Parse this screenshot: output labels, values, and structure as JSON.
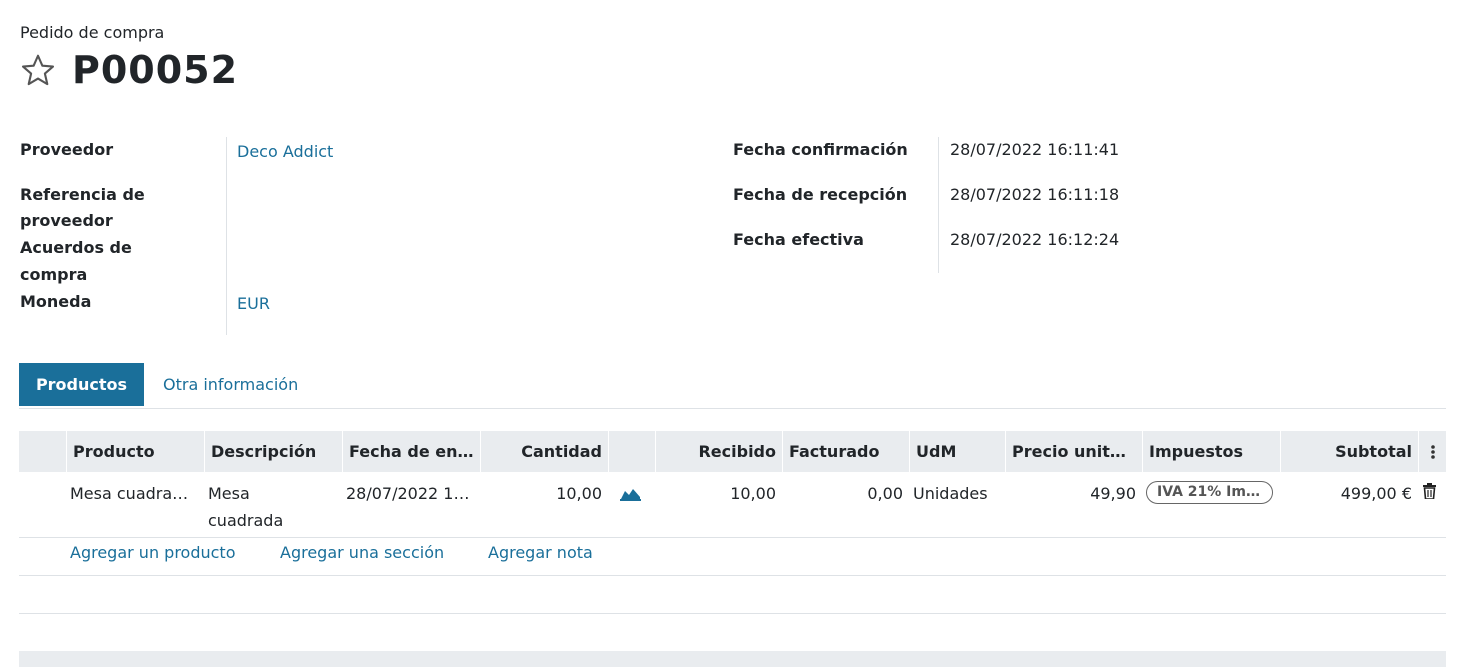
{
  "header": {
    "subtitle": "Pedido de compra",
    "title": "P00052"
  },
  "left_fields": {
    "vendor_label": "Proveedor",
    "vendor_value": "Deco Addict",
    "vendor_ref_label_1": "Referencia de",
    "vendor_ref_label_2": "proveedor",
    "agreement_label_1": "Acuerdos de",
    "agreement_label_2": "compra",
    "currency_label": "Moneda",
    "currency_value": "EUR"
  },
  "right_fields": {
    "confirm_label": "Fecha confirmación",
    "confirm_value": "28/07/2022 16:11:41",
    "receipt_label": "Fecha de recepción",
    "receipt_value": "28/07/2022 16:11:18",
    "effective_label": "Fecha efectiva",
    "effective_value": "28/07/2022 16:12:24"
  },
  "tabs": {
    "active": "Productos",
    "other": "Otra información"
  },
  "table": {
    "headers": {
      "product": "Producto",
      "description": "Descripción",
      "date": "Fecha de en…",
      "quantity": "Cantidad",
      "received": "Recibido",
      "billed": "Facturado",
      "uom": "UdM",
      "unit_price": "Precio unita…",
      "taxes": "Impuestos",
      "subtotal": "Subtotal"
    },
    "row": {
      "product": "Mesa cuadra…",
      "description_1": "Mesa",
      "description_2": "cuadrada",
      "date": "28/07/2022 1…",
      "quantity": "10,00",
      "received": "10,00",
      "billed": "0,00",
      "uom": "Unidades",
      "unit_price": "49,90",
      "taxes": "IVA 21% Im…",
      "subtotal": "499,00 €"
    },
    "add_product": "Agregar un producto",
    "add_section": "Agregar una sección",
    "add_note": "Agregar nota"
  },
  "colors": {
    "accent": "#1a6f9a",
    "header_bg": "#e9ecef"
  }
}
